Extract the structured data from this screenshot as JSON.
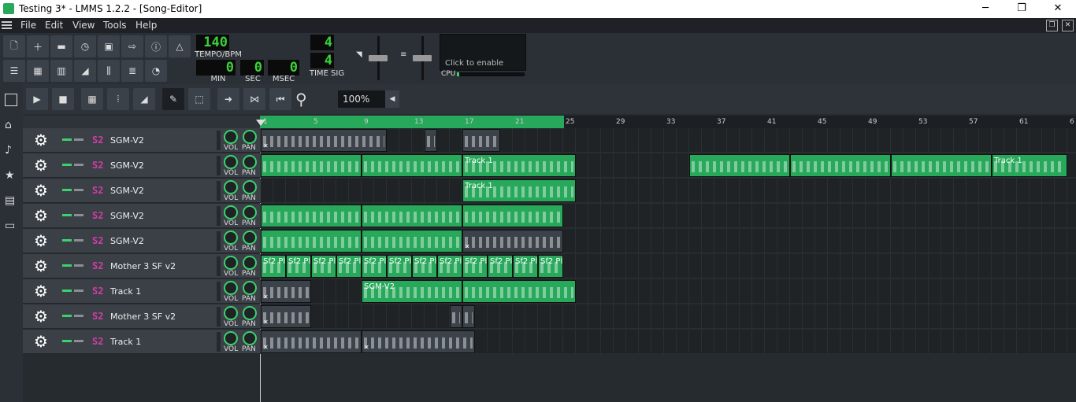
{
  "window": {
    "title": "Testing 3* - LMMS 1.2.2 - [Song-Editor]",
    "minimize": "─",
    "maximize": "❐",
    "close": "✕"
  },
  "menu": [
    "File",
    "Edit",
    "View",
    "Tools",
    "Help"
  ],
  "transport": {
    "tempo": "140",
    "tempo_label": "TEMPO/BPM",
    "min": "0",
    "sec": "0",
    "msec": "0",
    "min_label": "MIN",
    "sec_label": "SEC",
    "msec_label": "MSEC",
    "ts_num": "4",
    "ts_den": "4",
    "ts_label": "TIME SIG",
    "cpu_label": "CPU",
    "cpu_hint": "Click to enable"
  },
  "editor": {
    "zoom": "100%"
  },
  "timeline": {
    "bars": [
      "1",
      "5",
      "9",
      "13",
      "17",
      "21",
      "25",
      "29",
      "33",
      "37",
      "41",
      "45",
      "49",
      "53",
      "57",
      "61",
      "6"
    ]
  },
  "colors": {
    "accent": "#27a85a",
    "mute_on": "#3bd16c",
    "sf2": "#d23ca8"
  },
  "knobs": {
    "vol": "VOL",
    "pan": "PAN"
  },
  "tracks": [
    {
      "name": "SGM-V2",
      "clips": [
        {
          "label": "",
          "color": "k",
          "mx": true
        },
        {
          "label": "",
          "color": "k"
        },
        {
          "label": "",
          "color": "k"
        }
      ]
    },
    {
      "name": "SGM-V2",
      "clips": [
        {
          "label": "",
          "color": "g"
        },
        {
          "label": "",
          "color": "g"
        },
        {
          "label": "Track 1",
          "color": "g"
        },
        {
          "label": "",
          "color": "g"
        },
        {
          "label": "",
          "color": "g"
        },
        {
          "label": "",
          "color": "g"
        },
        {
          "label": "Track 1",
          "color": "g"
        }
      ]
    },
    {
      "name": "SGM-V2",
      "clips": [
        {
          "label": "Track 1",
          "color": "g"
        }
      ]
    },
    {
      "name": "SGM-V2",
      "clips": [
        {
          "label": "",
          "color": "g"
        },
        {
          "label": "",
          "color": "g"
        },
        {
          "label": "",
          "color": "g"
        }
      ]
    },
    {
      "name": "SGM-V2",
      "clips": [
        {
          "label": "",
          "color": "g"
        },
        {
          "label": "",
          "color": "g"
        },
        {
          "label": "",
          "color": "k",
          "mx": true
        }
      ]
    },
    {
      "name": "Mother 3 SF v2",
      "clips": [
        {
          "label": "Sf2 Pl"
        },
        {
          "label": "Sf2 Pl"
        },
        {
          "label": "Sf2 Pl"
        },
        {
          "label": "Sf2 Pl"
        },
        {
          "label": "Sf2 Pl"
        },
        {
          "label": "Sf2 Pl"
        },
        {
          "label": "Sf2 Pl"
        },
        {
          "label": "Sf2 Pl"
        },
        {
          "label": "Sf2 Pl"
        },
        {
          "label": "Sf2 Pl"
        },
        {
          "label": "Sf2 Pl"
        },
        {
          "label": "Sf2 Pl"
        }
      ]
    },
    {
      "name": "Track 1",
      "clips": [
        {
          "label": "",
          "color": "k",
          "mx": true
        },
        {
          "label": "SGM-V2",
          "color": "g"
        },
        {
          "label": "",
          "color": "g"
        }
      ]
    },
    {
      "name": "Mother 3 SF v2",
      "clips": [
        {
          "label": "",
          "color": "k",
          "mx": true
        },
        {
          "label": "",
          "color": "k"
        },
        {
          "label": "",
          "color": "k"
        }
      ]
    },
    {
      "name": "Track 1",
      "clips": [
        {
          "label": "",
          "color": "k",
          "mx": true
        },
        {
          "label": "",
          "color": "k",
          "mx": true
        }
      ]
    }
  ]
}
